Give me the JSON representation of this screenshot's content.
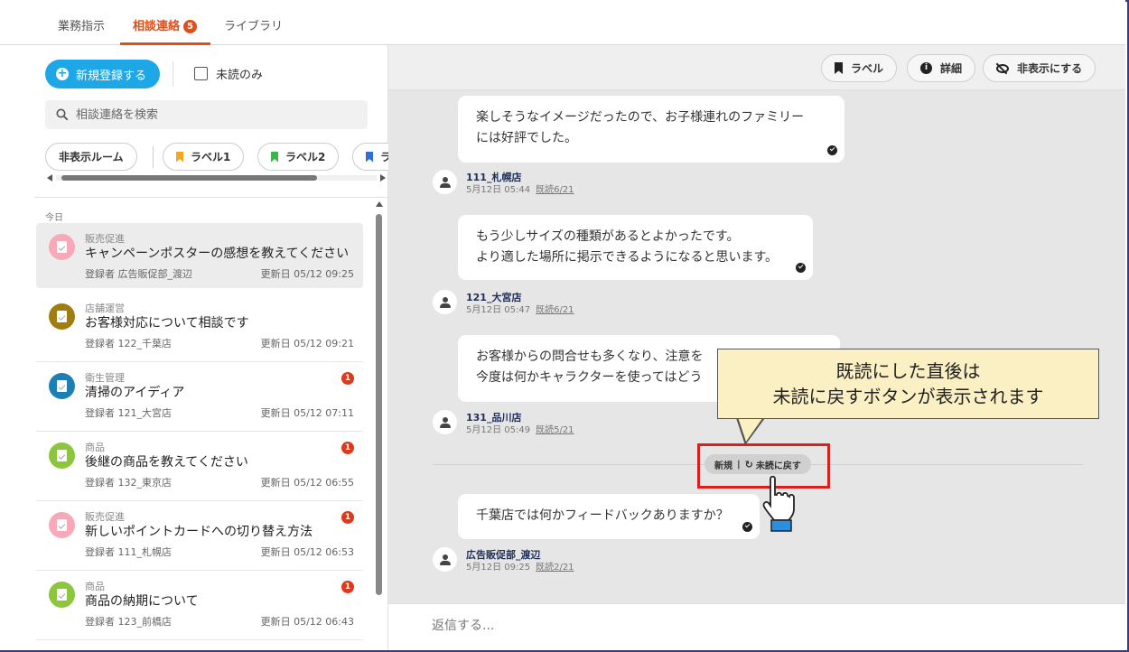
{
  "tabs": [
    {
      "label": "業務指示"
    },
    {
      "label": "相談連絡",
      "badge": "5"
    },
    {
      "label": "ライブラリ"
    }
  ],
  "sidebar": {
    "new_button_label": "新規登録する",
    "unread_only_label": "未読のみ",
    "search_placeholder": "相談連絡を検索",
    "filters": [
      {
        "label": "非表示ルーム"
      },
      {
        "label": "ラベル1",
        "color": "#f5a623"
      },
      {
        "label": "ラベル2",
        "color": "#3cb54a"
      },
      {
        "label": "ラ",
        "color": "#2f6fd8"
      }
    ],
    "section_label": "今日",
    "items": [
      {
        "category": "販売促進",
        "title": "キャンペーンポスターの感想を教えてください",
        "registrant": "登録者 広告販促部_渡辺",
        "updated": "更新日 05/12 09:25",
        "icon_color": "#f8a9b9",
        "badge": ""
      },
      {
        "category": "店舗運営",
        "title": "お客様対応について相談です",
        "registrant": "登録者 122_千葉店",
        "updated": "更新日 05/12 09:21",
        "icon_color": "#a07d12",
        "badge": ""
      },
      {
        "category": "衛生管理",
        "title": "清掃のアイディア",
        "registrant": "登録者 121_大宮店",
        "updated": "更新日 05/12 07:11",
        "icon_color": "#1e7fb5",
        "badge": "1"
      },
      {
        "category": "商品",
        "title": "後継の商品を教えてください",
        "registrant": "登録者 132_東京店",
        "updated": "更新日 05/12 06:55",
        "icon_color": "#8cc63e",
        "badge": "1"
      },
      {
        "category": "販売促進",
        "title": "新しいポイントカードへの切り替え方法",
        "registrant": "登録者 111_札幌店",
        "updated": "更新日 05/12 06:53",
        "icon_color": "#f8a9b9",
        "badge": "1"
      },
      {
        "category": "商品",
        "title": "商品の納期について",
        "registrant": "登録者 123_前橋店",
        "updated": "更新日 05/12 06:43",
        "icon_color": "#8cc63e",
        "badge": "1"
      }
    ]
  },
  "toolbar": {
    "label_button": "ラベル",
    "detail_button": "詳細",
    "hide_button": "非表示にする"
  },
  "messages": [
    {
      "lines": [
        "楽しそうなイメージだったので、お子様連れのファミリー",
        "には好評でした。"
      ],
      "sender": "111_札幌店",
      "time": "5月12日 05:44",
      "read": "既読6/21"
    },
    {
      "lines": [
        "もう少しサイズの種類があるとよかったです。",
        "より適した場所に掲示できるようになると思います。"
      ],
      "sender": "121_大宮店",
      "time": "5月12日 05:47",
      "read": "既読6/21"
    },
    {
      "lines": [
        "お客様からの問合せも多くなり、注意を",
        "今度は何かキャラクターを使ってはどう"
      ],
      "sender": "131_品川店",
      "time": "5月12日 05:49",
      "read": "既読5/21"
    },
    {
      "lines": [
        "千葉店では何かフィードバックありますか？"
      ],
      "sender": "広告販促部_渡辺",
      "time": "5月12日 09:25",
      "read": "既読2/21"
    }
  ],
  "unread_marker": {
    "new_label": "新規",
    "back_to_unread": "未読に戻す"
  },
  "callout": {
    "line1": "既読にした直後は",
    "line2": "未読に戻すボタンが表示されます"
  },
  "reply_placeholder": "返信する..."
}
